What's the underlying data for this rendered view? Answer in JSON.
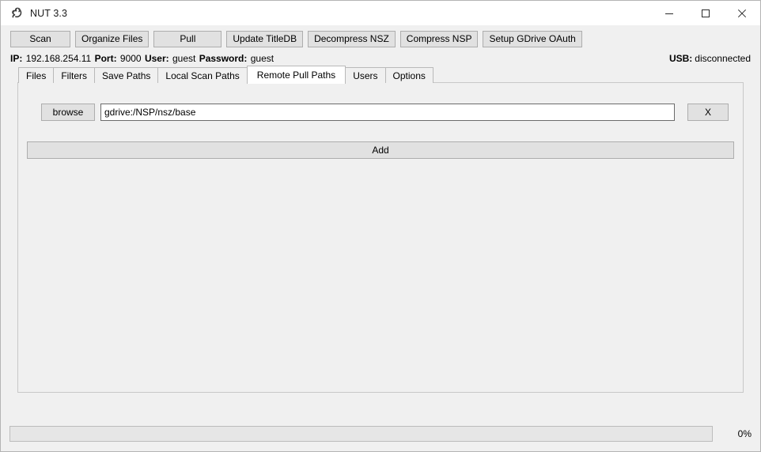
{
  "window": {
    "title": "NUT 3.3",
    "icon": "squirrel-icon",
    "controls": {
      "minimize": "–",
      "maximize": "☐",
      "close": "×"
    }
  },
  "toolbar": {
    "buttons": [
      {
        "label": "Scan",
        "name": "scan-button"
      },
      {
        "label": "Organize Files",
        "name": "organize-files-button"
      },
      {
        "label": "Pull",
        "name": "pull-button"
      },
      {
        "label": "Update TitleDB",
        "name": "update-titledb-button"
      },
      {
        "label": "Decompress NSZ",
        "name": "decompress-nsz-button"
      },
      {
        "label": "Compress NSP",
        "name": "compress-nsp-button"
      },
      {
        "label": "Setup GDrive OAuth",
        "name": "setup-gdrive-oauth-button"
      }
    ]
  },
  "status": {
    "ip_label": "IP:",
    "ip_value": "192.168.254.11",
    "port_label": "Port:",
    "port_value": "9000",
    "user_label": "User:",
    "user_value": "guest",
    "password_label": "Password:",
    "password_value": "guest",
    "usb_label": "USB:",
    "usb_value": "disconnected"
  },
  "tabs": [
    {
      "label": "Files",
      "active": false
    },
    {
      "label": "Filters",
      "active": false
    },
    {
      "label": "Save Paths",
      "active": false
    },
    {
      "label": "Local Scan Paths",
      "active": false
    },
    {
      "label": "Remote Pull Paths",
      "active": true
    },
    {
      "label": "Users",
      "active": false
    },
    {
      "label": "Options",
      "active": false
    }
  ],
  "remote_pull_paths": {
    "browse_label": "browse",
    "path_value": "gdrive:/NSP/nsz/base",
    "path_placeholder": "",
    "remove_label": "X",
    "add_label": "Add"
  },
  "footer": {
    "progress_percent": 0,
    "progress_label": "0%"
  },
  "colors": {
    "window_bg": "#f0f0f0",
    "titlebar_bg": "#ffffff",
    "button_face": "#e1e1e1",
    "button_border": "#adadad",
    "panel_border": "#c8c8c8",
    "active_tab_bg": "#ffffff",
    "input_bg": "#ffffff",
    "input_border": "#6b6b6b",
    "progress_fill": "#06b025"
  }
}
